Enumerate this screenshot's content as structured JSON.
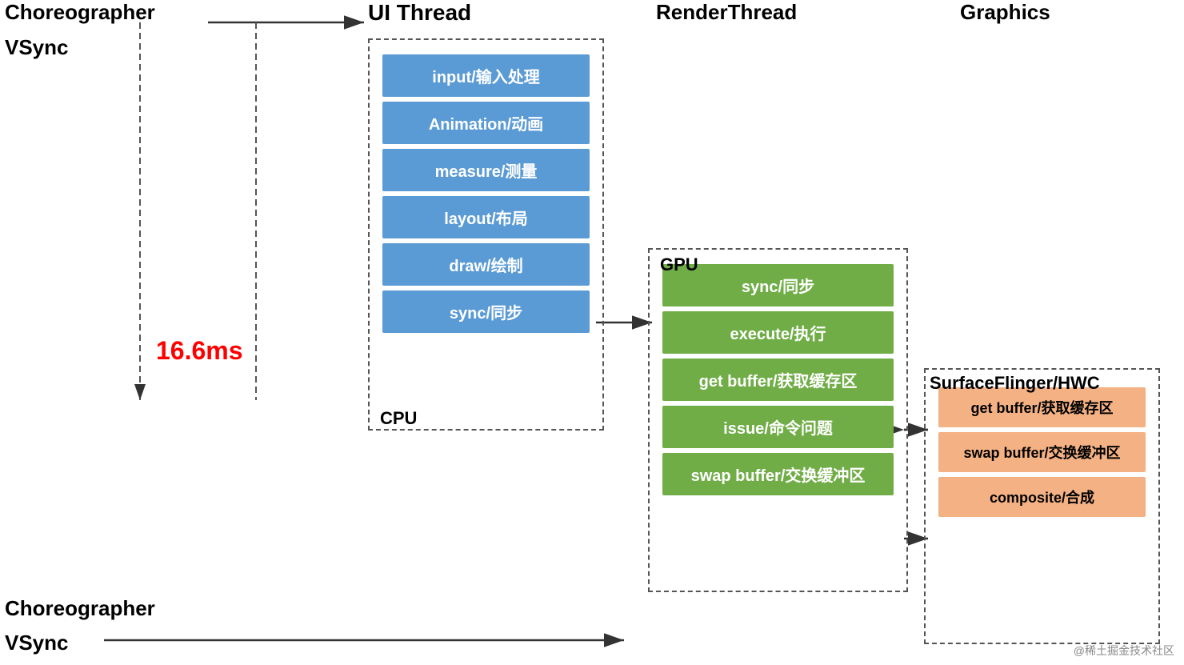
{
  "headers": {
    "choreographer": "Choreographer",
    "vsync1": "VSync",
    "vsync2": "VSync",
    "ui_thread": "UI Thread",
    "render_thread": "RenderThread",
    "graphics": "Graphics"
  },
  "labels": {
    "cpu": "CPU",
    "gpu": "GPU",
    "surface_flinger": "SurfaceFlinger/HWC",
    "timing": "16.6ms",
    "watermark": "@稀土掘金技术社区"
  },
  "blue_blocks": [
    "input/输入处理",
    "Animation/动画",
    "measure/测量",
    "layout/布局",
    "draw/绘制",
    "sync/同步"
  ],
  "green_blocks": [
    "sync/同步",
    "execute/执行",
    "get buffer/获取缓存区",
    "issue/命令问题",
    "swap buffer/交换缓冲区"
  ],
  "orange_blocks": [
    "get buffer/获取缓存区",
    "swap buffer/交换缓冲区",
    "composite/合成"
  ]
}
